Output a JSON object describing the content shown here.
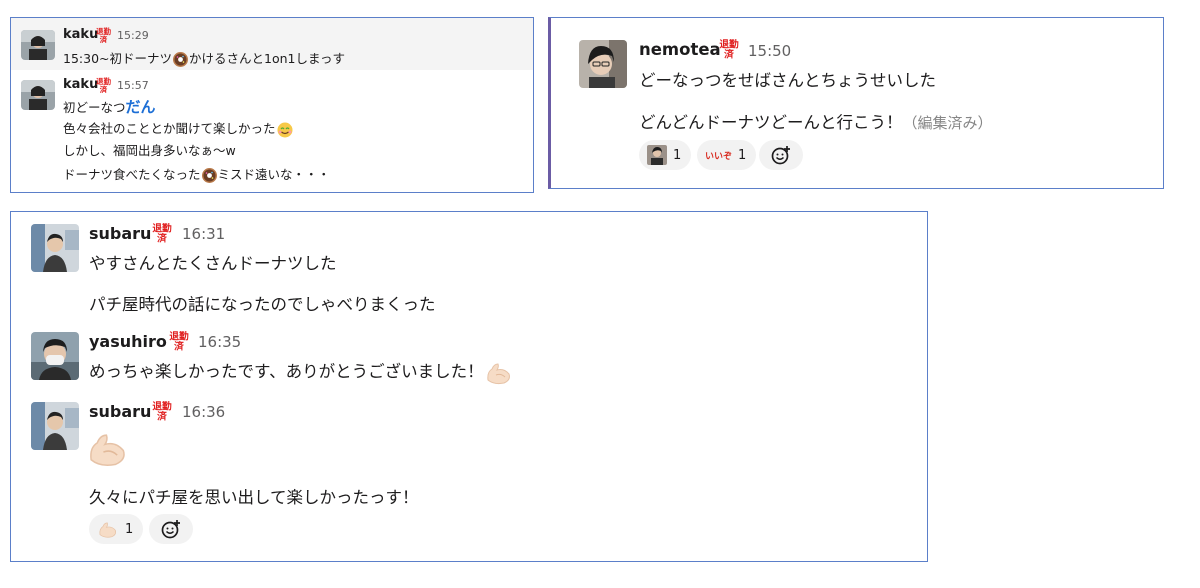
{
  "badge_text": "退勤済",
  "panel1": {
    "messages": [
      {
        "user": "kaku",
        "time": "15:29",
        "lines": [
          "15:30~初ドーナツ",
          "かけるさんと1on1しまっす"
        ]
      },
      {
        "user": "kaku",
        "time": "15:57",
        "lines": [
          "初どーなつ",
          "だん",
          "色々会社のこととか聞けて楽しかった",
          "しかし、福岡出身多いなぁ〜w",
          "ドーナツ食べたくなった",
          "ミスド遠いな・・・"
        ]
      }
    ]
  },
  "panel2": {
    "message": {
      "user": "nemotea",
      "time": "15:50",
      "lines": [
        "どーなっつをせばさんとちょうせいした",
        "どんどんドーナツどーんと行こう！"
      ],
      "edited": "（編集済み）"
    },
    "reactions": [
      {
        "emoji": "person-photo",
        "count": "1"
      },
      {
        "emoji": "iine",
        "label": "いいぞ",
        "count": "1"
      }
    ]
  },
  "panel3": {
    "messages": [
      {
        "user": "subaru",
        "time": "16:31",
        "lines": [
          "やすさんとたくさんドーナツした",
          "パチ屋時代の話になったのでしゃべりまくった"
        ]
      },
      {
        "user": "yasuhiro",
        "time": "16:35",
        "lines": [
          "めっちゃ楽しかったです、ありがとうございました！"
        ]
      },
      {
        "user": "subaru",
        "time": "16:36",
        "lines": [
          "久々にパチ屋を思い出して楽しかったっす！"
        ]
      }
    ],
    "reactions": [
      {
        "emoji": "flexed-arm",
        "count": "1"
      }
    ]
  },
  "colors": {
    "panel_border": "#5b7fc9",
    "accent_bar": "#6b5ca5",
    "badge_red": "#e01e1e",
    "time_gray": "#616061",
    "dan_blue": "#1d6fd6"
  }
}
